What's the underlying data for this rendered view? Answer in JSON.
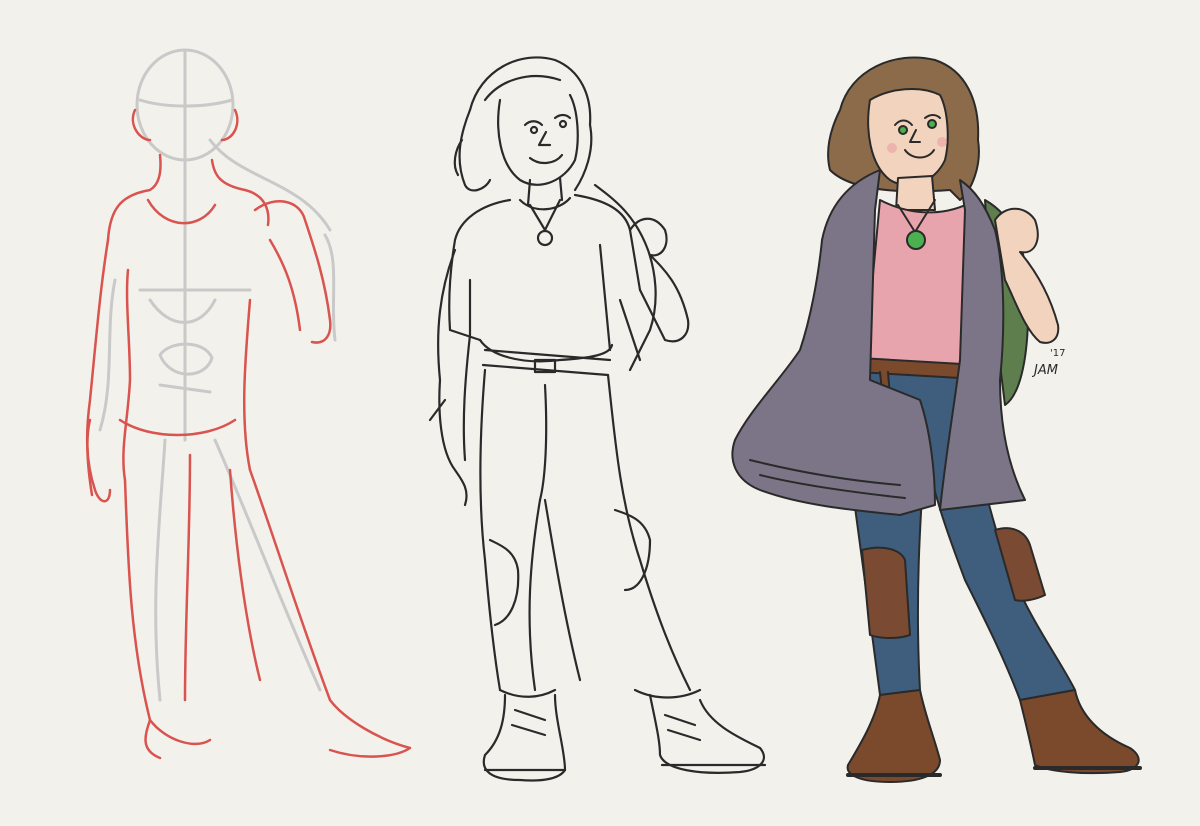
{
  "artwork": {
    "stages": [
      {
        "id": "construction",
        "stroke_color": "#d9534f",
        "guide_color": "#c9c9c9"
      },
      {
        "id": "lineart",
        "stroke_color": "#2a2a2a"
      },
      {
        "id": "colored",
        "stroke_color": "#2a2a2a"
      }
    ],
    "palette": {
      "background": "#f3f1ec",
      "hair": "#8b6b4a",
      "skin": "#f2d3bd",
      "shirt": "#e8a4ad",
      "cardigan": "#7b7587",
      "jeans": "#3f5e7d",
      "patch": "#7a4a32",
      "boots": "#7b4a2d",
      "pendant": "#4caf50",
      "backpack": "#5e7f4d"
    },
    "signature": {
      "text_line1": "'17",
      "text_line2": "JAM"
    }
  }
}
